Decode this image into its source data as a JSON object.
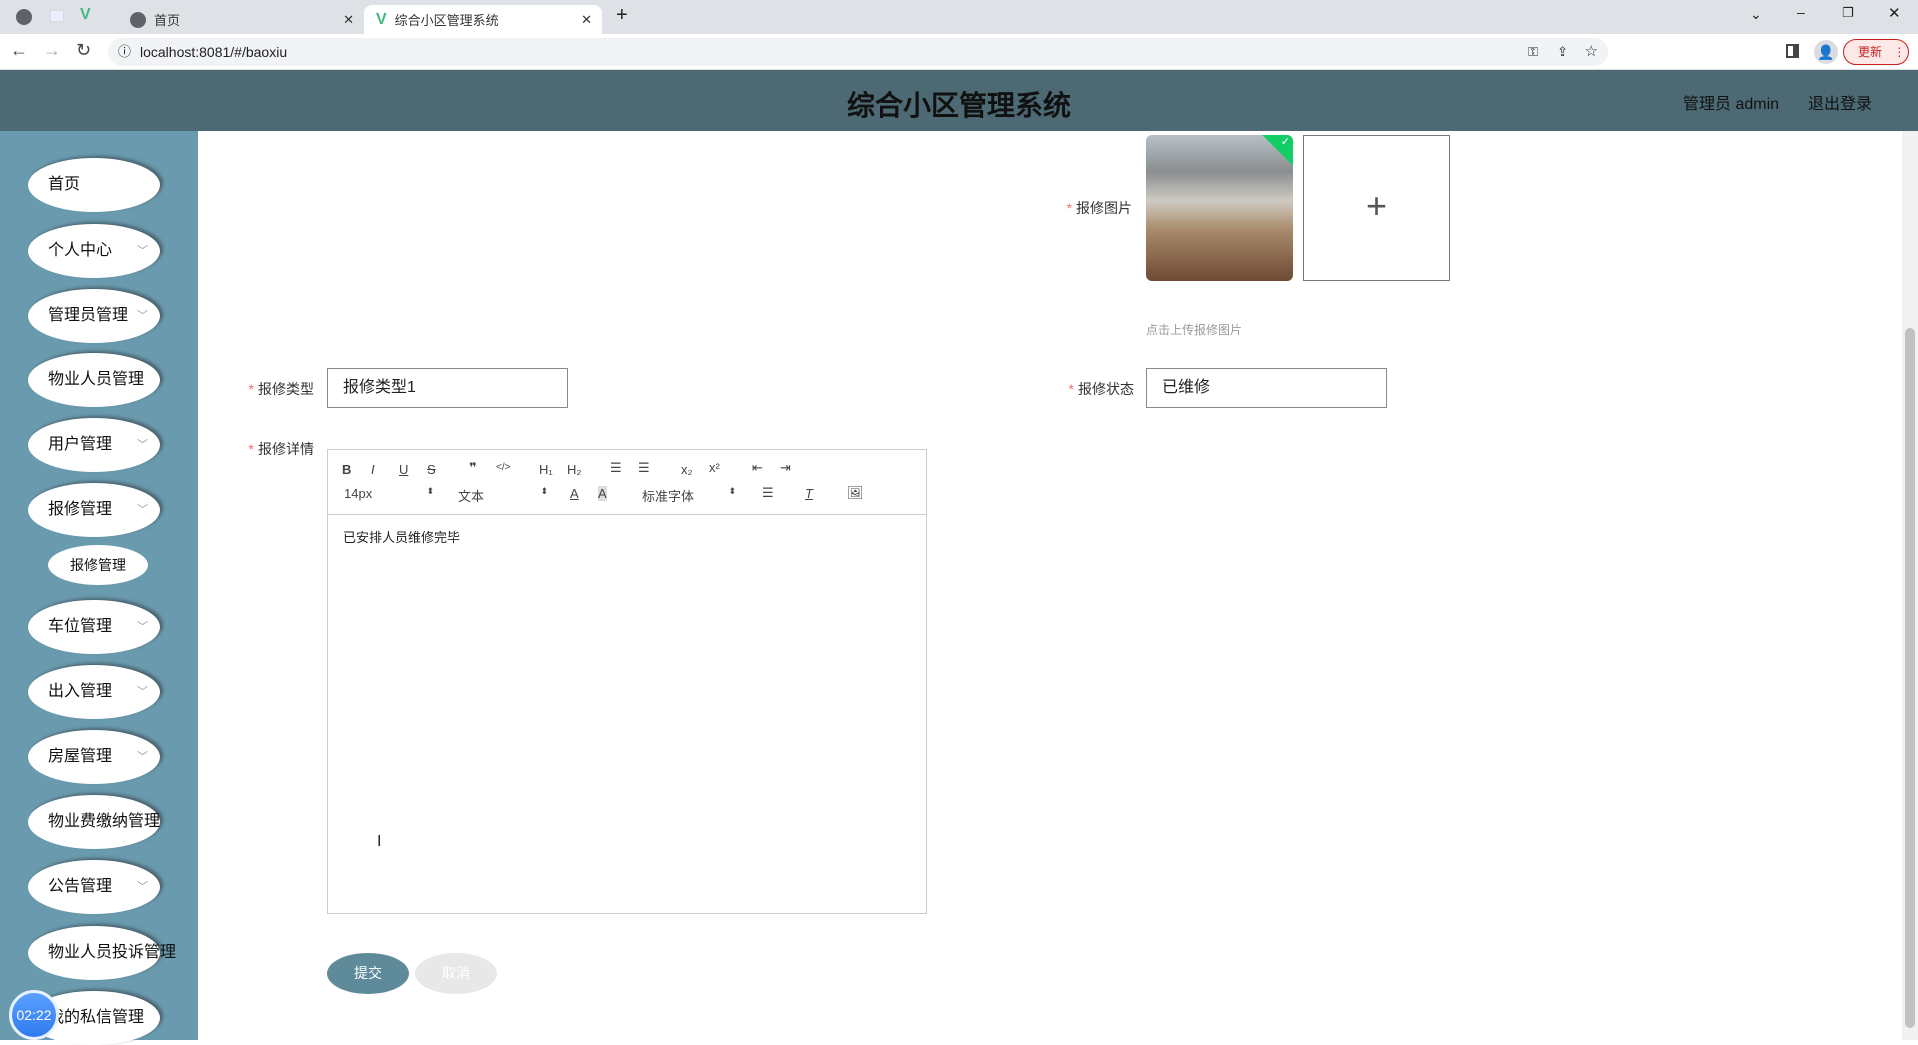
{
  "browser": {
    "tabs": [
      {
        "label": "首页"
      },
      {
        "label": "综合小区管理系统"
      }
    ],
    "url": "localhost:8081/#/baoxiu",
    "update_label": "更新"
  },
  "header": {
    "title": "综合小区管理系统",
    "user": "管理员 admin",
    "logout": "退出登录"
  },
  "sidebar": {
    "items": [
      {
        "label": "首页",
        "chev": false
      },
      {
        "label": "个人中心",
        "chev": true
      },
      {
        "label": "管理员管理",
        "chev": true
      },
      {
        "label": "物业人员管理",
        "chev": false
      },
      {
        "label": "用户管理",
        "chev": true
      },
      {
        "label": "报修管理",
        "chev": true
      },
      {
        "label": "车位管理",
        "chev": true
      },
      {
        "label": "出入管理",
        "chev": true
      },
      {
        "label": "房屋管理",
        "chev": true
      },
      {
        "label": "物业费缴纳管理",
        "chev": false
      },
      {
        "label": "公告管理",
        "chev": true
      },
      {
        "label": "物业人员投诉管理",
        "chev": false
      },
      {
        "label": "我的私信管理",
        "chev": false
      }
    ],
    "sub_item": "报修管理"
  },
  "timer": "02:22",
  "form": {
    "image_label": "报修图片",
    "image_hint": "点击上传报修图片",
    "type_label": "报修类型",
    "type_value": "报修类型1",
    "status_label": "报修状态",
    "status_value": "已维修",
    "detail_label": "报修详情",
    "editor": {
      "font_size": "14px",
      "header": "文本",
      "font": "标准字体",
      "content": "已安排人员维修完毕"
    },
    "submit": "提交",
    "cancel": "取消"
  }
}
